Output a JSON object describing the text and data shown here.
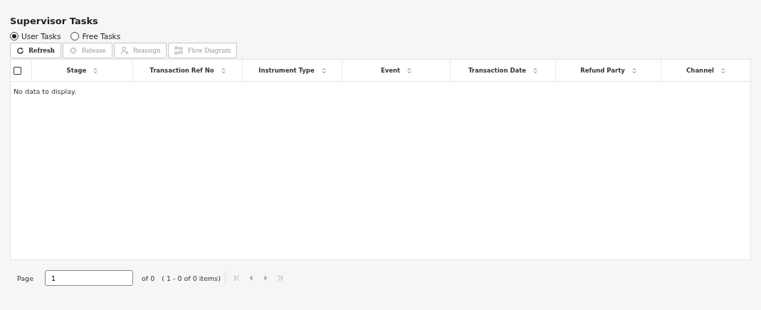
{
  "title": "Supervisor Tasks",
  "task_types": [
    {
      "label": "User Tasks",
      "selected": true
    },
    {
      "label": "Free Tasks",
      "selected": false
    }
  ],
  "toolbar": [
    {
      "label": "Refresh",
      "kind": "refresh",
      "disabled": false
    },
    {
      "label": "Release",
      "kind": "release",
      "disabled": true
    },
    {
      "label": "Reassign",
      "kind": "reassign",
      "disabled": true
    },
    {
      "label": "Flow Diagram",
      "kind": "flow",
      "disabled": true
    }
  ],
  "table": {
    "select_all": {
      "checked": false
    },
    "columns": [
      "Stage",
      "Transaction Ref No",
      "Instrument Type",
      "Event",
      "Transaction Date",
      "Refund Party",
      "Channel"
    ],
    "empty_message": "No data to display."
  },
  "pager": {
    "label": "Page",
    "value": "1",
    "of": "of 0",
    "range": "( 1 - 0 of 0 items)",
    "first_disabled": true,
    "prev_disabled": true,
    "next_disabled": true,
    "last_disabled": true
  }
}
